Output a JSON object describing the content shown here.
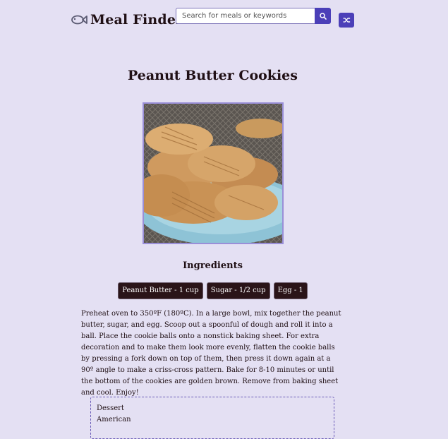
{
  "header": {
    "app_title": "Meal Finder",
    "logo_icon": "fish-icon",
    "search": {
      "placeholder": "Search for meals or keywords",
      "value": "",
      "button_icon": "search-icon"
    },
    "random_button_icon": "shuffle-icon",
    "accent_color": "#4b3fb8"
  },
  "meal": {
    "title": "Peanut Butter Cookies",
    "image_alt": "Peanut Butter Cookies",
    "ingredients_heading": "Ingredients",
    "ingredients": [
      "Peanut Butter - 1 cup",
      "Sugar - 1/2 cup",
      "Egg - 1"
    ],
    "instructions": "Preheat oven to 350ºF (180ºC). In a large bowl, mix together the peanut butter, sugar, and egg. Scoop out a spoonful of dough and roll it into a ball. Place the cookie balls onto a nonstick baking sheet. For extra decoration and to make them look more evenly, flatten the cookie balls by pressing a fork down on top of them, then press it down again at a 90º angle to make a criss-cross pattern. Bake for 8-10 minutes or until the bottom of the cookies are golden brown. Remove from baking sheet and cool. Enjoy!",
    "category": "Dessert",
    "area": "American"
  }
}
